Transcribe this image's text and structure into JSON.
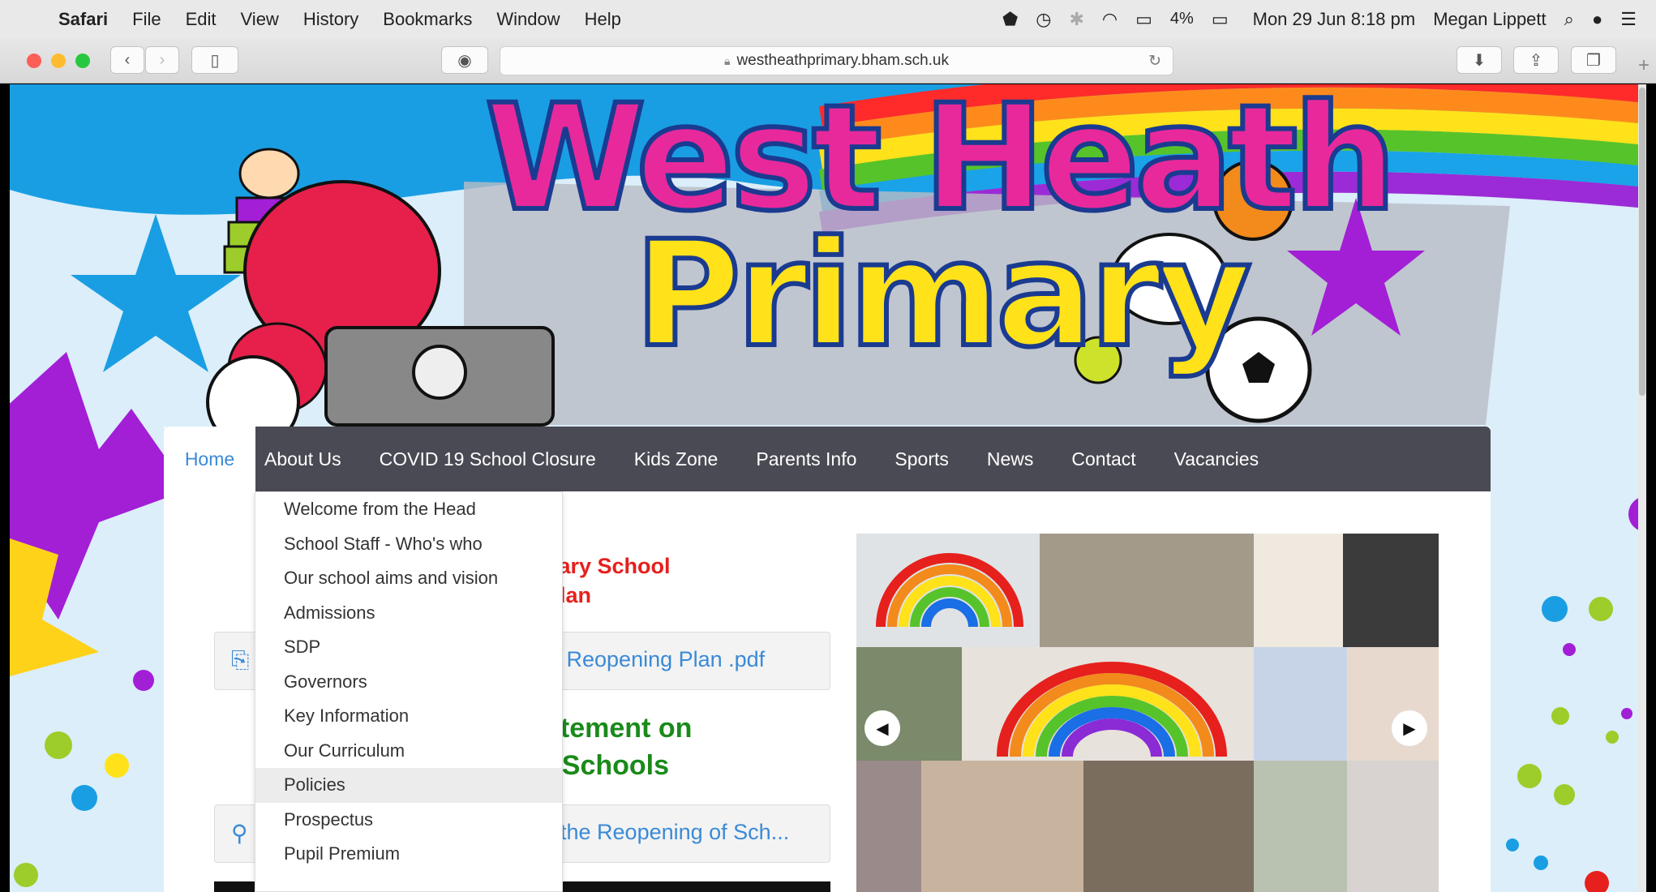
{
  "menubar": {
    "apple": "",
    "app": "Safari",
    "menus": [
      "File",
      "Edit",
      "View",
      "History",
      "Bookmarks",
      "Window",
      "Help"
    ],
    "battery": "4%",
    "datetime": "Mon 29 Jun  8:18 pm",
    "user": "Megan Lippett"
  },
  "browser": {
    "url": "westheathprimary.bham.sch.uk"
  },
  "logo": {
    "line1": "West Heath",
    "line2": "Primary"
  },
  "nav": {
    "home": "Home",
    "items": [
      "About Us",
      "COVID 19 School Closure",
      "Kids Zone",
      "Parents Info",
      "Sports",
      "News",
      "Contact",
      "Vacancies"
    ]
  },
  "dropdown": {
    "items": [
      "Welcome from the Head",
      "School Staff - Who's who",
      "Our school aims and vision",
      "Admissions",
      "SDP",
      "Governors",
      "Key Information",
      "Our Curriculum",
      "Policies",
      "Prospectus",
      "Pupil Premium"
    ],
    "active_index": 8
  },
  "main": {
    "heading1_line1": "hary School",
    "heading1_line2": "Plan",
    "doc1_link": "l Reopening Plan .pdf",
    "heading2_line1": "atement on",
    "heading2_line2": "f Schools",
    "doc2_link": "the Reopening of Sch..."
  },
  "colors": {
    "nav_bg": "#4a4a54",
    "link": "#3a8ad6",
    "heading_red": "#e6201c",
    "heading_green": "#1a8a1a",
    "page_bg": "#dbeefa"
  }
}
